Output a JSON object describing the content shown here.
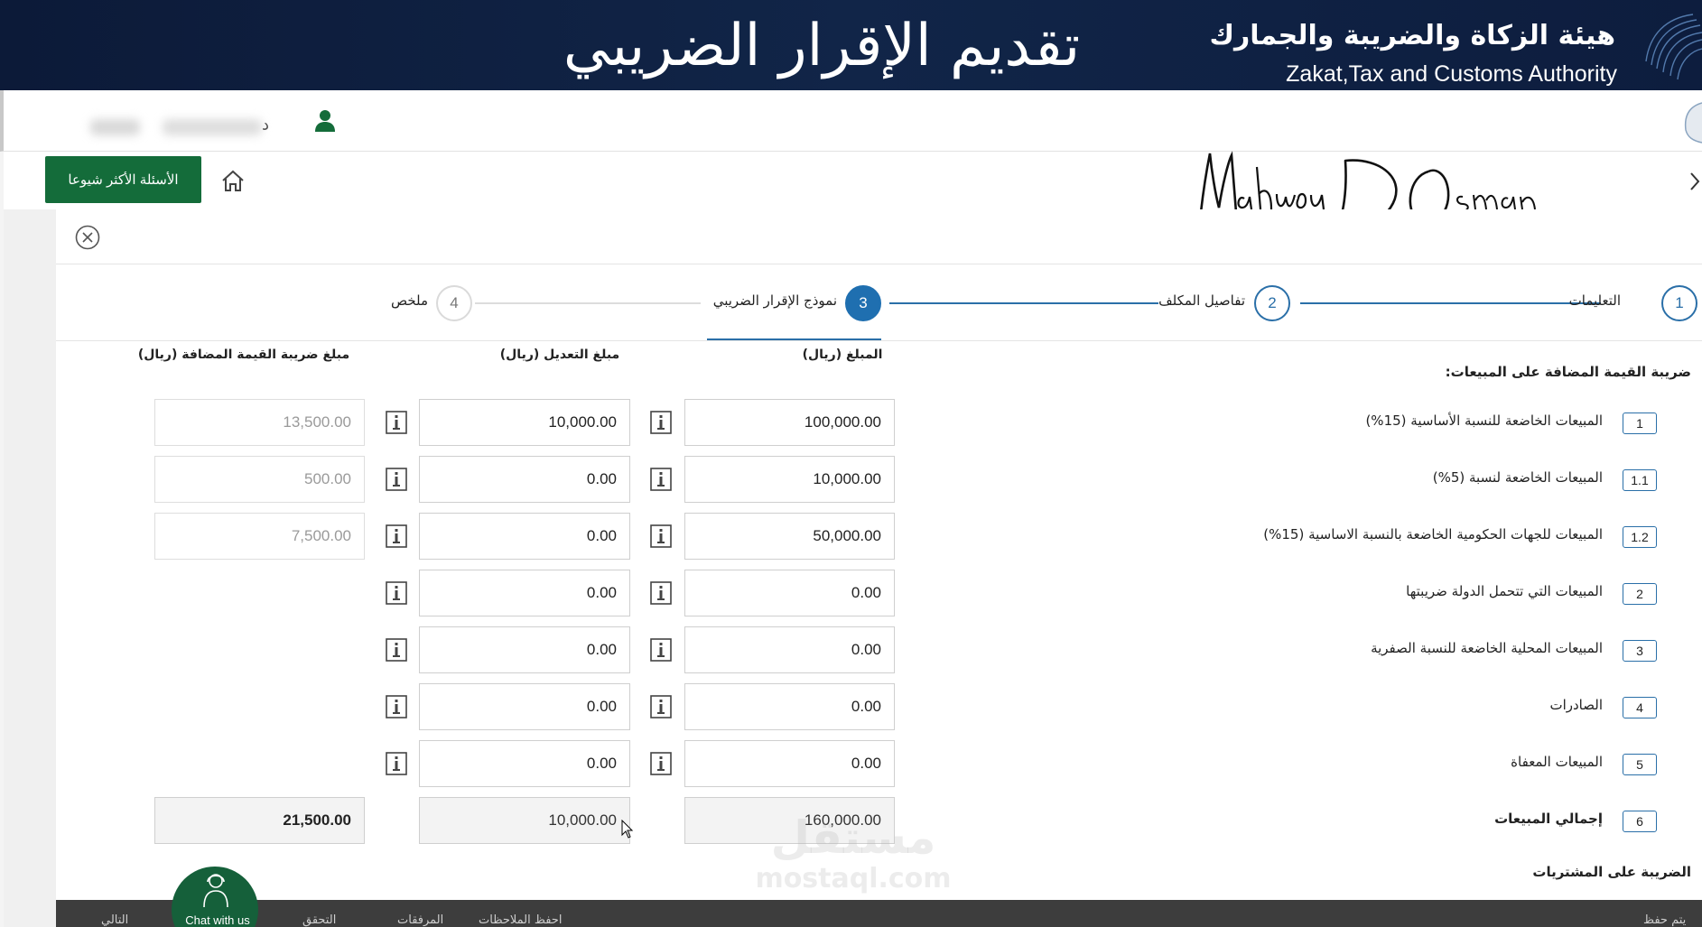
{
  "banner": {
    "title": "تقديم الإقرار الضريبي",
    "authority_ar": "هيئة الزكاة والضريبة والجمارك",
    "authority_en": "Zakat,Tax and Customs Authority"
  },
  "userbar": {
    "separator": "د"
  },
  "nav": {
    "faq_label": "الأسئلة الأكثر شيوعا",
    "signature": "MahmouD Osman"
  },
  "stepper": {
    "steps": [
      {
        "number": "1",
        "label": "التعليمات",
        "state": "done"
      },
      {
        "number": "2",
        "label": "تفاصيل المكلف",
        "state": "done"
      },
      {
        "number": "3",
        "label": "نموذج الإقرار الضريبي",
        "state": "active"
      },
      {
        "number": "4",
        "label": "ملخص",
        "state": "pending"
      }
    ]
  },
  "columns": {
    "amount": "المبلغ (ريال)",
    "adjustment": "مبلغ التعديل (ريال)",
    "vat": "مبلغ ضريبة القيمة المضافة (ريال)"
  },
  "sections": {
    "sales": "ضريبة القيمة المضافة على المبيعات:",
    "purchases": "الضريبة على المشتريات"
  },
  "rows": [
    {
      "num": "1",
      "label": "المبيعات الخاضعة للنسبة الأساسية (15%)",
      "amount": "100,000.00",
      "adjustment": "10,000.00",
      "vat": "13,500.00"
    },
    {
      "num": "1.1",
      "label": "المبيعات الخاضعة لنسبة (5%)",
      "amount": "10,000.00",
      "adjustment": "0.00",
      "vat": "500.00"
    },
    {
      "num": "1.2",
      "label": "المبيعات للجهات الحكومية الخاضعة بالنسبة الاساسية (15%)",
      "amount": "50,000.00",
      "adjustment": "0.00",
      "vat": "7,500.00"
    },
    {
      "num": "2",
      "label": "المبيعات التي تتحمل الدولة ضريبتها",
      "amount": "0.00",
      "adjustment": "0.00",
      "vat": ""
    },
    {
      "num": "3",
      "label": "المبيعات المحلية الخاضعة للنسبة الصفرية",
      "amount": "0.00",
      "adjustment": "0.00",
      "vat": ""
    },
    {
      "num": "4",
      "label": "الصادرات",
      "amount": "0.00",
      "adjustment": "0.00",
      "vat": ""
    },
    {
      "num": "5",
      "label": "المبيعات المعفاة",
      "amount": "0.00",
      "adjustment": "0.00",
      "vat": ""
    }
  ],
  "total_row": {
    "num": "6",
    "label": "إجمالي المبيعات",
    "amount": "160,000.00",
    "adjustment": "10,000.00",
    "vat": "21,500.00"
  },
  "watermark": {
    "line1": "مستقل",
    "line2": "mostaql.com"
  },
  "bottombar": {
    "chat_label": "Chat with us",
    "items": [
      "التالي",
      "التحقق",
      "المرفقات",
      "احفظ الملاحظات"
    ],
    "right_text": "يتم حفظ"
  },
  "colors": {
    "banner_bg": "#0c1a38",
    "accent_blue": "#1f6fb0",
    "faq_green": "#146c3a",
    "chat_green": "#15603a"
  }
}
